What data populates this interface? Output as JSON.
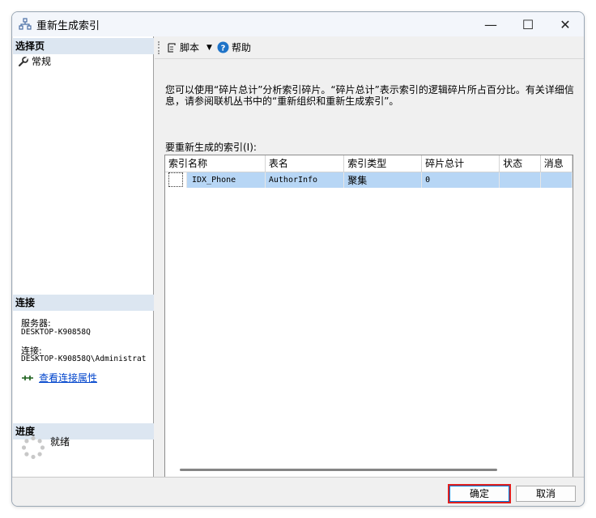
{
  "window": {
    "title": "重新生成索引"
  },
  "title_buttons": {
    "minimize": "—",
    "maximize": "☐",
    "close": "✕"
  },
  "left": {
    "select_page_header": "选择页",
    "pages": [
      {
        "label": "常规"
      }
    ],
    "connection_header": "连接",
    "server_label": "服务器:",
    "server_value": "DESKTOP-K90858Q",
    "connection_label": "连接:",
    "connection_value": "DESKTOP-K90858Q\\Administrat",
    "view_connection_props": "查看连接属性",
    "progress_header": "进度",
    "progress_status": "就绪"
  },
  "toolbar": {
    "script_label": "脚本",
    "help_label": "帮助"
  },
  "description": "您可以使用“碎片总计”分析索引碎片。“碎片总计”表示索引的逻辑碎片所占百分比。有关详细信息，请参阅联机丛书中的“重新组织和重新生成索引”。",
  "grid": {
    "label": "要重新生成的索引(I):",
    "columns": [
      "索引名称",
      "表名",
      "索引类型",
      "碎片总计",
      "状态",
      "消息"
    ],
    "rows": [
      {
        "index_name": "IDX_Phone",
        "table": "AuthorInfo",
        "index_type": "聚集",
        "fragmentation": "0",
        "status": "",
        "message": ""
      }
    ]
  },
  "buttons": {
    "ok": "确定",
    "cancel": "取消"
  },
  "colors": {
    "accent": "#0078d7",
    "highlight_row": "#b7d6f5",
    "focus_outline": "#e02020",
    "link": "#0044cc"
  }
}
